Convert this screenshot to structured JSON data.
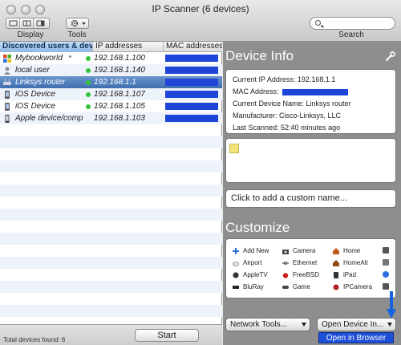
{
  "window": {
    "title": "IP Scanner (6 devices)"
  },
  "toolbar": {
    "display_label": "Display",
    "tools_label": "Tools",
    "search_label": "Search"
  },
  "table": {
    "columns": [
      "Discovered users & devices ▾",
      "IP addresses",
      "MAC addresses"
    ],
    "rows": [
      {
        "name": "Mybookworld",
        "ip": "192.168.1.100",
        "icon": "windows-icon",
        "selected": false
      },
      {
        "name": "local user",
        "ip": "192.168.1.140",
        "icon": "user-icon",
        "selected": false
      },
      {
        "name": "Linksys router",
        "ip": "192.168.1.1",
        "icon": "router-icon",
        "selected": true
      },
      {
        "name": "iOS Device",
        "ip": "192.168.1.107",
        "icon": "ios-device-icon",
        "selected": false
      },
      {
        "name": "iOS Device",
        "ip": "192.168.1.105",
        "icon": "ios-device-icon",
        "selected": false
      },
      {
        "name": "Apple device/compu...",
        "ip": "192.168.1.103",
        "icon": "phone-icon",
        "selected": false
      }
    ],
    "status_color": "#36c43a",
    "redaction_color": "#1e44d8"
  },
  "footer": {
    "total_label": "Total devices found: 6",
    "start_label": "Start"
  },
  "device_info": {
    "title": "Device Info",
    "current_ip": "Current IP Address:  192.168.1.1",
    "mac_label": "MAC Address:",
    "device_name": "Current Device Name:  Linksys router",
    "manufacturer": "Manufacturer:  Cisco-Linksys, LLC",
    "last_scanned": "Last Scanned:  52:40 minutes ago"
  },
  "custom_name_placeholder": "Click to add a custom name...",
  "customize": {
    "title": "Customize",
    "items": [
      {
        "label": "Add New",
        "icon": "plus-icon"
      },
      {
        "label": "Camera",
        "icon": "camera-icon"
      },
      {
        "label": "Home",
        "icon": "home-icon"
      },
      {
        "label": "Airport",
        "icon": "airport-icon"
      },
      {
        "label": "Ethernet",
        "icon": "ethernet-icon"
      },
      {
        "label": "HomeAlt",
        "icon": "home-alt-icon"
      },
      {
        "label": "AppleTV",
        "icon": "apple-tv-icon"
      },
      {
        "label": "FreeBSD",
        "icon": "freebsd-icon"
      },
      {
        "label": "iPad",
        "icon": "ipad-icon"
      },
      {
        "label": "BluRay",
        "icon": "bluray-icon"
      },
      {
        "label": "Game",
        "icon": "gamepad-icon"
      },
      {
        "label": "IPCamera",
        "icon": "ip-camera-icon"
      }
    ]
  },
  "actions": {
    "network_tools_label": "Network Tools...",
    "open_device_label": "Open Device In...",
    "open_in_browser_label": "Open in Browser"
  },
  "colors": {
    "accent": "#1d4fd8",
    "pane_bg": "#8e8e8e",
    "arrow": "#1565e0"
  }
}
